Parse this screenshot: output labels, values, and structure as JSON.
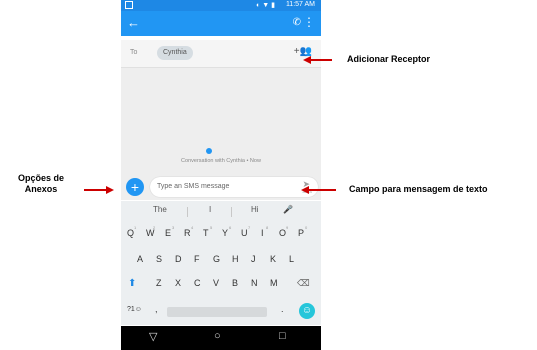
{
  "status_bar": {
    "time": "11:57 AM",
    "signal_icons": "◐ ▼ ▮"
  },
  "app_bar": {
    "back_icon": "arrow-left",
    "call_icon": "phone",
    "more_icon": "more-vertical",
    "color": "#2196f3"
  },
  "recipients": {
    "to_label": "To",
    "contact": "Cynthia",
    "add_icon": "person-add"
  },
  "conversation": {
    "info": "Conversation with Cynthia • Now"
  },
  "composer": {
    "placeholder": "Type an SMS message",
    "send_label": "SMS"
  },
  "keyboard": {
    "suggestions": [
      "The",
      "I",
      "Hi"
    ],
    "row1": [
      "Q",
      "W",
      "E",
      "R",
      "T",
      "Y",
      "U",
      "I",
      "O",
      "P"
    ],
    "row1_numbers": [
      "1",
      "2",
      "3",
      "4",
      "5",
      "6",
      "7",
      "8",
      "9",
      "0"
    ],
    "row2": [
      "A",
      "S",
      "D",
      "F",
      "G",
      "H",
      "J",
      "K",
      "L"
    ],
    "row3": [
      "Z",
      "X",
      "C",
      "V",
      "B",
      "N",
      "M"
    ],
    "symbols_label": "?1☺",
    "comma": ",",
    "period": "."
  },
  "annotations": {
    "add_receiver": "Adicionar Receptor",
    "attach_options_line1": "Opções de",
    "attach_options_line2": "Anexos",
    "text_field": "Campo para mensagem de texto",
    "arrow_color": "#cc0000"
  }
}
